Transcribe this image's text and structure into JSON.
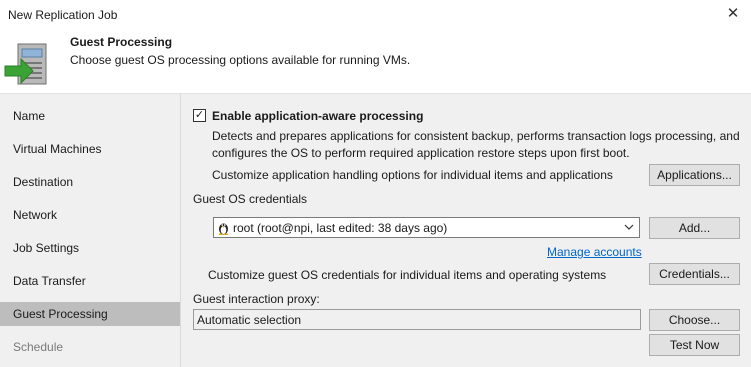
{
  "window": {
    "title": "New Replication Job",
    "close_icon": "close-icon"
  },
  "header": {
    "title": "Guest Processing",
    "subtitle": "Choose guest OS processing options available for running VMs.",
    "icon": "server-arrow-icon"
  },
  "sidebar": {
    "items": [
      {
        "label": "Name",
        "state": "normal"
      },
      {
        "label": "Virtual Machines",
        "state": "normal"
      },
      {
        "label": "Destination",
        "state": "normal"
      },
      {
        "label": "Network",
        "state": "normal"
      },
      {
        "label": "Job Settings",
        "state": "normal"
      },
      {
        "label": "Data Transfer",
        "state": "normal"
      },
      {
        "label": "Guest Processing",
        "state": "active"
      },
      {
        "label": "Schedule",
        "state": "disabled"
      }
    ]
  },
  "app_aware": {
    "checkbox_label": "Enable application-aware processing",
    "checked": true,
    "description_line1": "Detects and prepares applications for consistent backup, performs transaction logs processing, and",
    "description_line2": "configures the OS to perform required application restore steps upon first boot.",
    "customize_text": "Customize application handling options for individual items and applications",
    "applications_button": "Applications..."
  },
  "credentials": {
    "section_label": "Guest OS credentials",
    "selected_value": "root (root@npi, last edited: 38 days ago)",
    "selected_icon": "linux-penguin-icon",
    "add_button": "Add...",
    "manage_link": "Manage accounts",
    "customize_text": "Customize guest OS credentials for individual items and operating systems",
    "credentials_button": "Credentials..."
  },
  "proxy": {
    "label": "Guest interaction proxy:",
    "value": "Automatic selection",
    "choose_button": "Choose...",
    "test_button": "Test Now"
  },
  "colors": {
    "sidebar_bg": "#f0f0f0",
    "active_item_bg": "#bdbdbd",
    "link": "#0066cc",
    "arrow_green": "#3aa335"
  }
}
